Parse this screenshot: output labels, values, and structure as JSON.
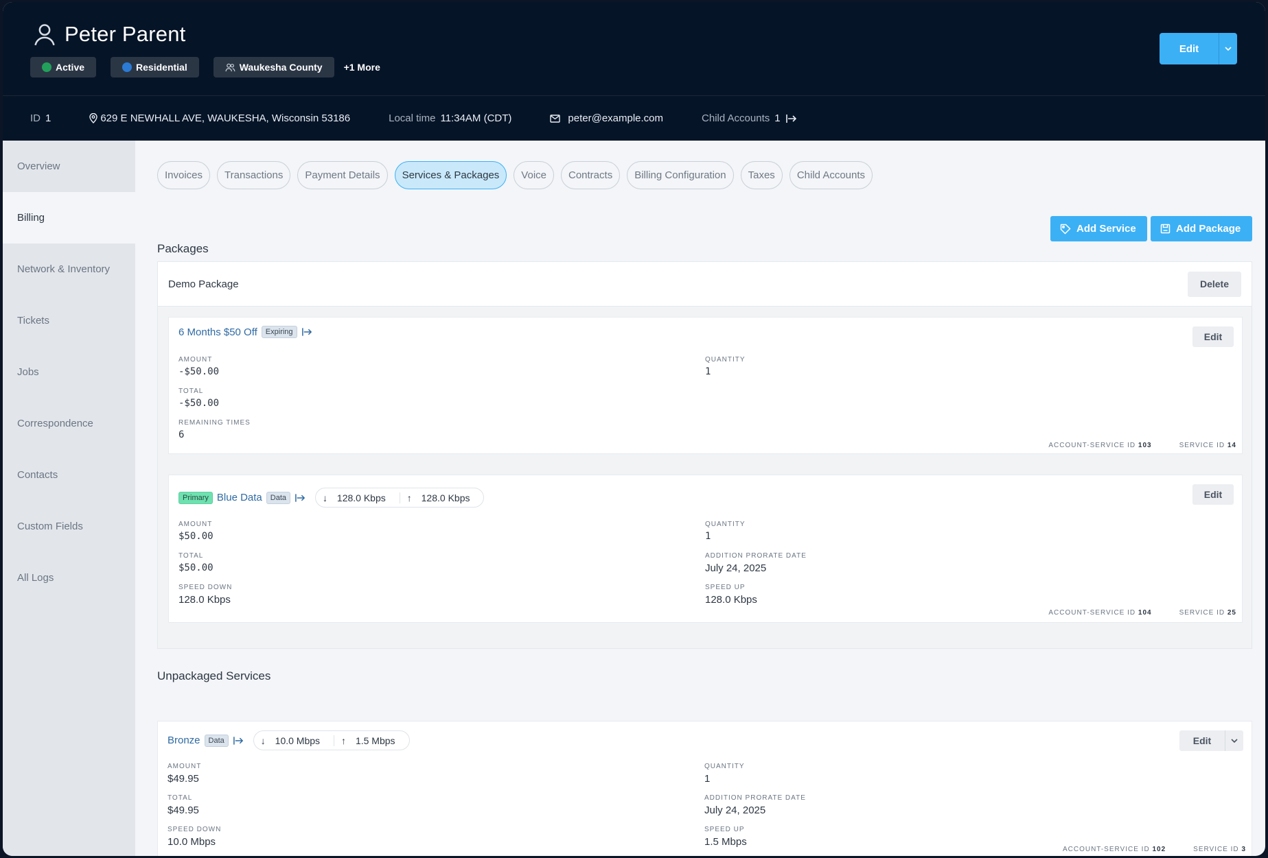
{
  "header": {
    "name": "Peter Parent",
    "badges": [
      {
        "label": "Active",
        "color": "#22a05b"
      },
      {
        "label": "Residential",
        "color": "#2b7bd6"
      },
      {
        "label": "Waukesha County"
      }
    ],
    "more_label": "+1 More",
    "edit_label": "Edit"
  },
  "info": {
    "id_label": "ID",
    "id_value": "1",
    "address": "629 E NEWHALL AVE, WAUKESHA, Wisconsin 53186",
    "local_time_label": "Local time",
    "local_time_value": "11:34AM (CDT)",
    "email": "peter@example.com",
    "child_accounts_label": "Child Accounts",
    "child_accounts_value": "1"
  },
  "sidebar": {
    "items": [
      {
        "label": "Overview"
      },
      {
        "label": "Billing"
      },
      {
        "label": "Network & Inventory"
      },
      {
        "label": "Tickets"
      },
      {
        "label": "Jobs"
      },
      {
        "label": "Correspondence"
      },
      {
        "label": "Contacts"
      },
      {
        "label": "Custom Fields"
      },
      {
        "label": "All Logs"
      }
    ]
  },
  "tabs": [
    {
      "label": "Invoices"
    },
    {
      "label": "Transactions"
    },
    {
      "label": "Payment Details"
    },
    {
      "label": "Services & Packages"
    },
    {
      "label": "Voice"
    },
    {
      "label": "Contracts"
    },
    {
      "label": "Billing Configuration"
    },
    {
      "label": "Taxes"
    },
    {
      "label": "Child Accounts"
    }
  ],
  "actions": {
    "add_service": "Add Service",
    "add_package": "Add Package"
  },
  "packages": {
    "title": "Packages",
    "package_name": "Demo Package",
    "delete_label": "Delete",
    "services": [
      {
        "name": "6 Months $50 Off",
        "tag": "Expiring",
        "edit_label": "Edit",
        "amount_label": "AMOUNT",
        "amount": "-$50.00",
        "quantity_label": "QUANTITY",
        "quantity": "1",
        "total_label": "TOTAL",
        "total": "-$50.00",
        "remaining_label": "REMAINING TIMES",
        "remaining": "6",
        "account_service_label": "ACCOUNT-SERVICE ID",
        "account_service_id": "103",
        "service_label": "SERVICE ID",
        "service_id": "14"
      },
      {
        "primary": "Primary",
        "name": "Blue Data",
        "tag": "Data",
        "down": "128.0 Kbps",
        "up": "128.0 Kbps",
        "edit_label": "Edit",
        "amount_label": "AMOUNT",
        "amount": "$50.00",
        "quantity_label": "QUANTITY",
        "quantity": "1",
        "total_label": "TOTAL",
        "total": "$50.00",
        "prorate_label": "ADDITION PRORATE DATE",
        "prorate": "July 24, 2025",
        "speed_down_label": "SPEED DOWN",
        "speed_down": "128.0 Kbps",
        "speed_up_label": "SPEED UP",
        "speed_up": "128.0 Kbps",
        "account_service_label": "ACCOUNT-SERVICE ID",
        "account_service_id": "104",
        "service_label": "SERVICE ID",
        "service_id": "25"
      }
    ]
  },
  "unpackaged": {
    "title": "Unpackaged Services",
    "service": {
      "name": "Bronze",
      "tag": "Data",
      "down": "10.0 Mbps",
      "up": "1.5 Mbps",
      "edit_label": "Edit",
      "amount_label": "AMOUNT",
      "amount": "$49.95",
      "quantity_label": "QUANTITY",
      "quantity": "1",
      "total_label": "TOTAL",
      "total": "$49.95",
      "prorate_label": "ADDITION PRORATE DATE",
      "prorate": "July 24, 2025",
      "speed_down_label": "SPEED DOWN",
      "speed_down": "10.0 Mbps",
      "speed_up_label": "SPEED UP",
      "speed_up": "1.5 Mbps",
      "account_service_label": "ACCOUNT-SERVICE ID",
      "account_service_id": "102",
      "service_label": "SERVICE ID",
      "service_id": "3"
    }
  }
}
